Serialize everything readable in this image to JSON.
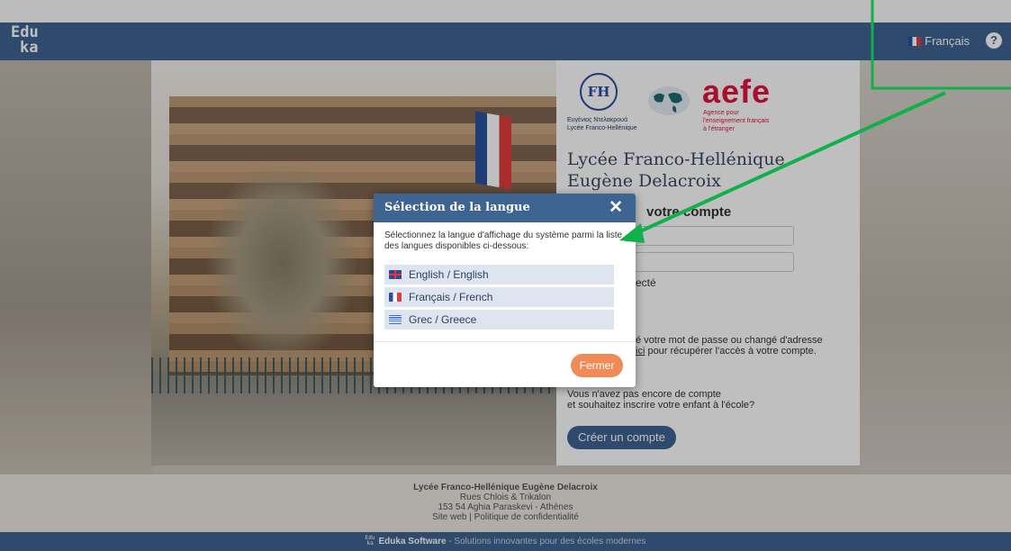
{
  "header": {
    "logo_line1": "Edu",
    "logo_line2": "ka",
    "language": "Français",
    "help": "?"
  },
  "school": {
    "lh_initials": "FH",
    "lh_caption_line1": "Ευγένιος Ντελακρουά",
    "lh_caption_line2": "Lycée Franco-Hellénique",
    "aefe_word": "aefe",
    "aefe_tag_line1": "Agence pour",
    "aefe_tag_line2": "l'enseignement français",
    "aefe_tag_line3": "à l'étranger",
    "title": "Lycée Franco-Hellénique Eugène Delacroix"
  },
  "login": {
    "heading_visible": "votre compte",
    "remember_visible": "ecté",
    "forgot_line1_visible": "é votre mot de passe ou changé d'adresse",
    "forgot_link": "ici",
    "forgot_line2_visible": " pour récupérer l'accès à votre compte.",
    "no_account_line1": "Vous n'avez pas encore de compte",
    "no_account_line2": "et souhaitez inscrire votre enfant à l'école?",
    "create_button": "Créer un compte"
  },
  "modal": {
    "title": "Sélection de la langue",
    "close": "✕",
    "description": "Sélectionnez la langue d'affichage du système parmi la liste des langues disponibles ci-dessous:",
    "options": [
      {
        "label": "English / English",
        "flag": "uk-flag-icon"
      },
      {
        "label": "Français / French",
        "flag": "fr-flag-icon"
      },
      {
        "label": "Grec / Greece",
        "flag": "gr-flag-icon"
      }
    ],
    "close_button": "Fermer"
  },
  "footer": {
    "name": "Lycée Franco-Hellénique Eugène Delacroix",
    "address1": "Rues Chlois & Trikalon",
    "address2": "153 54 Aghia Paraskevi - Athènes",
    "link_site": "Site web",
    "separator": " | ",
    "link_privacy": "Politique de confidentialité"
  },
  "bottombar": {
    "mini_logo_line1": "Edu",
    "mini_logo_line2": "ka",
    "brand": "Eduka Software",
    "tagline": " - Solutions innovantes pour des écoles modernes"
  },
  "colors": {
    "header": "#3e6592",
    "accent_orange": "#f08b57",
    "aefe_red": "#e0143c",
    "annotation_green": "#10b04a"
  }
}
